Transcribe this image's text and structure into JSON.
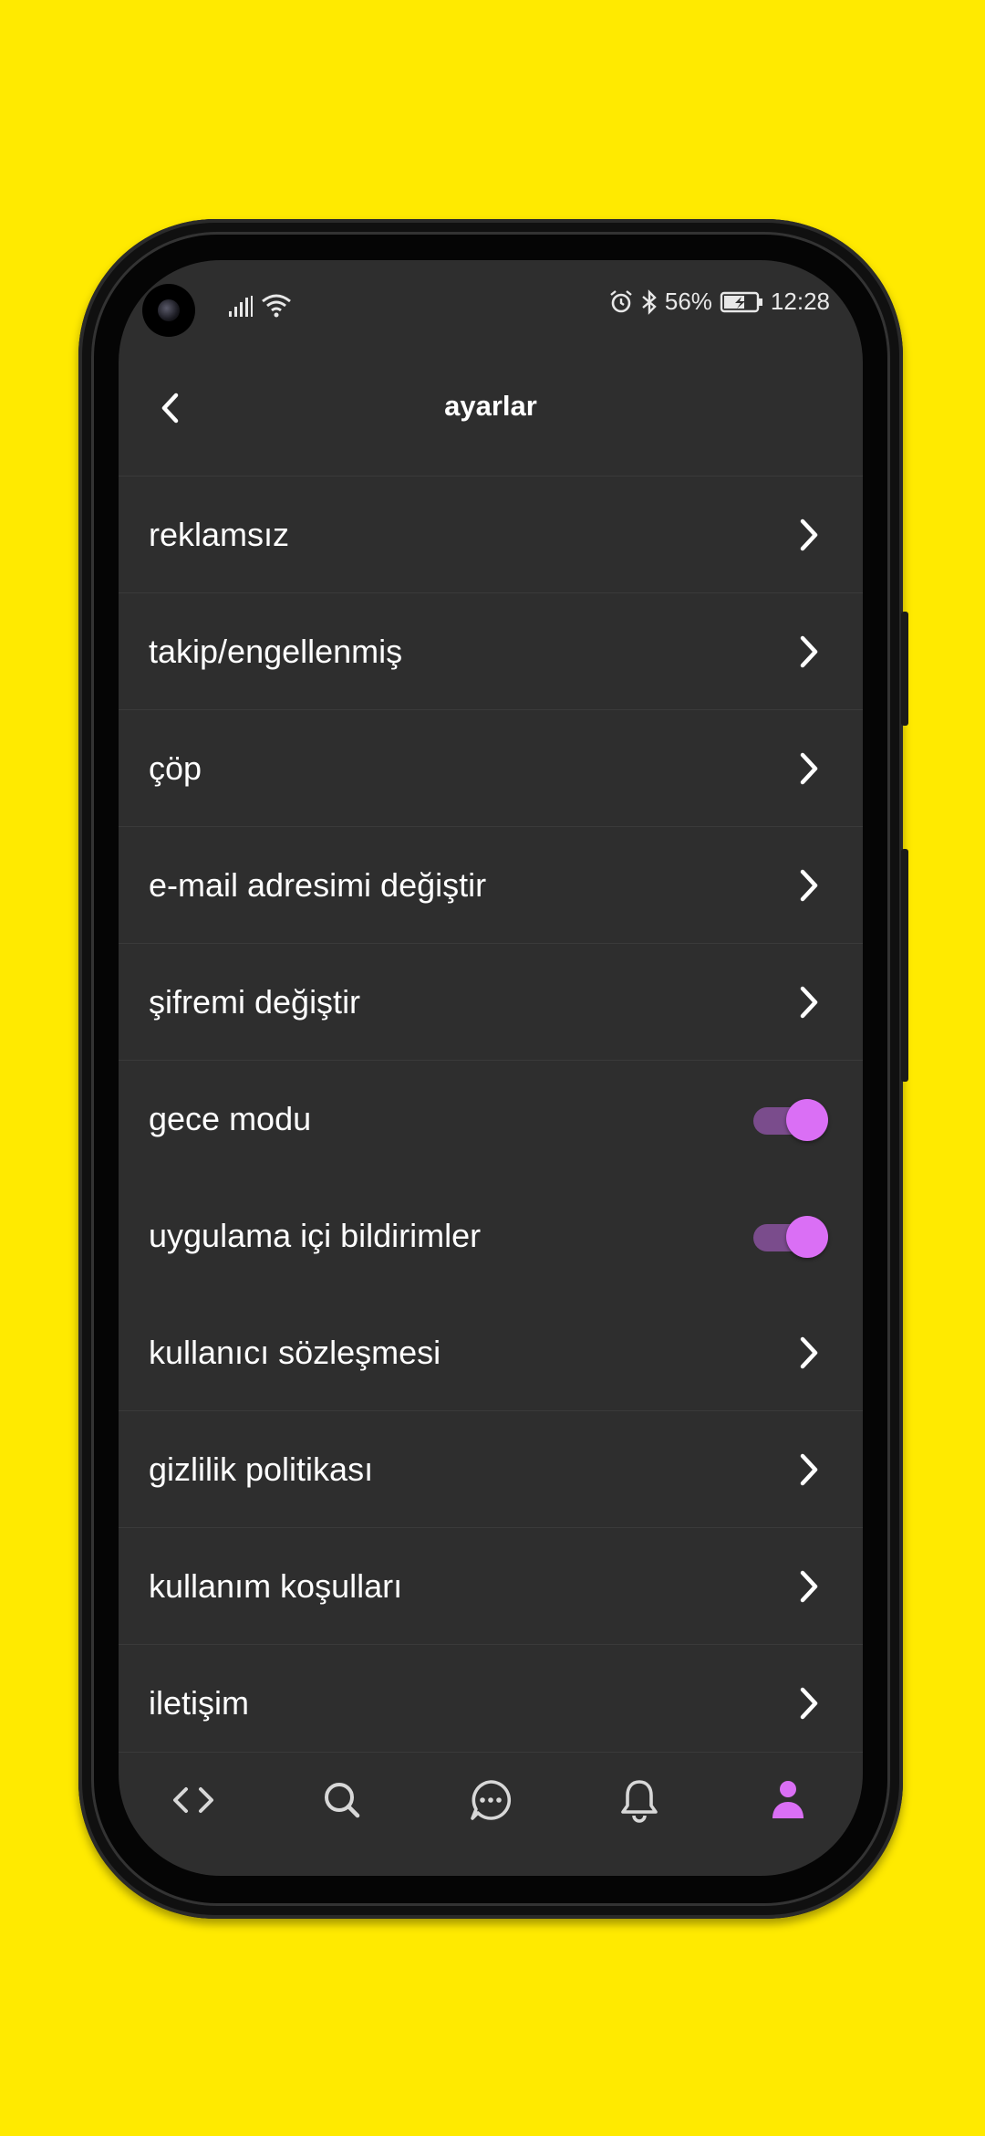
{
  "status_bar": {
    "battery_percent": "56%",
    "time": "12:28",
    "icons": [
      "signal-icon",
      "wifi-icon",
      "alarm-icon",
      "bluetooth-icon",
      "battery-charging-icon"
    ]
  },
  "header": {
    "title": "ayarlar",
    "back_icon": "chevron-left-icon"
  },
  "menu": {
    "items": [
      {
        "label": "reklamsız",
        "type": "link"
      },
      {
        "label": "takip/engellenmiş",
        "type": "link"
      },
      {
        "label": "çöp",
        "type": "link"
      },
      {
        "label": "e-mail adresimi değiştir",
        "type": "link"
      },
      {
        "label": "şifremi değiştir",
        "type": "link"
      },
      {
        "label": "gece modu",
        "type": "toggle",
        "on": true
      },
      {
        "label": "uygulama içi bildirimler",
        "type": "toggle",
        "on": true
      },
      {
        "label": "kullanıcı sözleşmesi",
        "type": "link"
      },
      {
        "label": "gizlilik politikası",
        "type": "link"
      },
      {
        "label": "kullanım koşulları",
        "type": "link"
      },
      {
        "label": "iletişim",
        "type": "link"
      }
    ]
  },
  "bottom_nav": {
    "items": [
      "code-icon",
      "search-icon",
      "chat-icon",
      "bell-icon",
      "profile-icon"
    ],
    "active": "profile-icon"
  },
  "colors": {
    "background": "#FFEA00",
    "screen": "#2E2E2E",
    "accent": "#DA6FF5",
    "toggle_track": "#7A4C8C",
    "text": "#FFFFFF"
  }
}
